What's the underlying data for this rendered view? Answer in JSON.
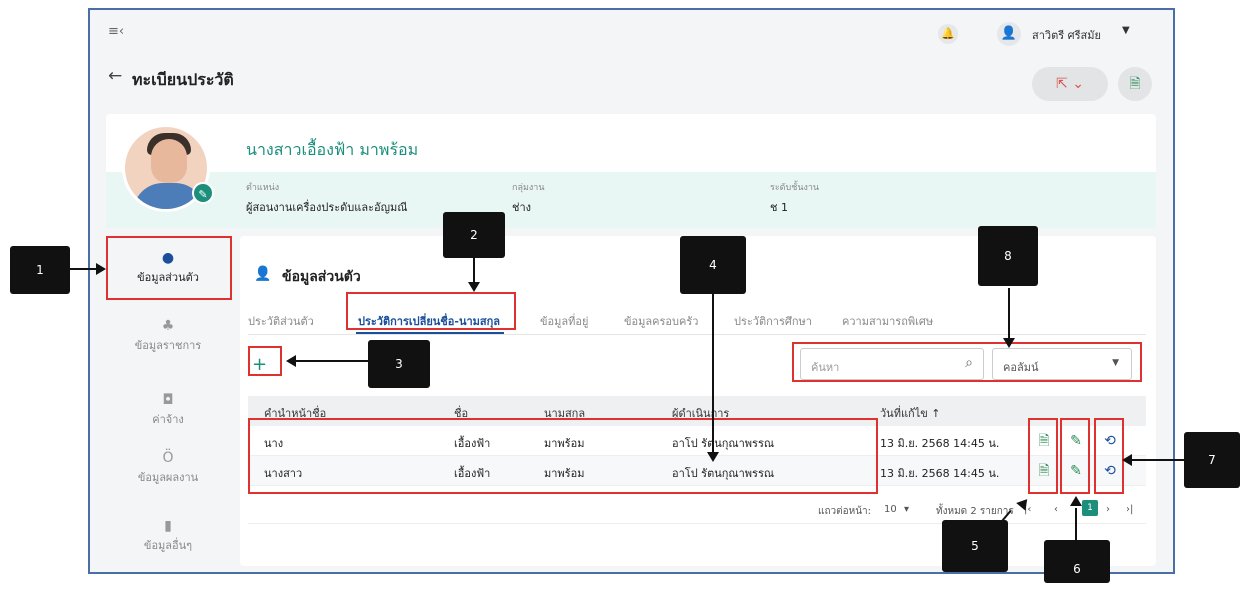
{
  "header": {
    "menu_icon": "menu-collapse-icon",
    "user_name": "สาวิตรี ศรีสมัย",
    "page_title": "ทะเบียนประวัติ"
  },
  "profile": {
    "name": "นางสาวเอื้องฟ้า มาพร้อม",
    "fields": [
      {
        "label": "ตำแหน่ง",
        "value": "ผู้สอนงานเครื่องประดับและอัญมณี"
      },
      {
        "label": "กลุ่มงาน",
        "value": "ช่าง"
      },
      {
        "label": "ระดับชั้นงาน",
        "value": "ช 1"
      }
    ]
  },
  "sidebar": {
    "items": [
      {
        "label": "ข้อมูลส่วนตัว",
        "icon": "person-icon"
      },
      {
        "label": "ข้อมูลราชการ",
        "icon": "org-icon"
      },
      {
        "label": "ค่าจ้าง",
        "icon": "money-icon"
      },
      {
        "label": "ข้อมูลผลงาน",
        "icon": "medal-icon"
      },
      {
        "label": "ข้อมูลอื่นๆ",
        "icon": "bookmark-icon"
      }
    ]
  },
  "main": {
    "section_title": "ข้อมูลส่วนตัว",
    "tabs": [
      {
        "label": "ประวัติส่วนตัว"
      },
      {
        "label": "ประวัติการเปลี่ยนชื่อ-นามสกุล"
      },
      {
        "label": "ข้อมูลที่อยู่"
      },
      {
        "label": "ข้อมูลครอบครัว"
      },
      {
        "label": "ประวัติการศึกษา"
      },
      {
        "label": "ความสามารถพิเศษ"
      }
    ],
    "search_placeholder": "ค้นหา",
    "column_select": "คอลัมน์",
    "table": {
      "headers": [
        "คำนำหน้าชื่อ",
        "ชื่อ",
        "นามสกุล",
        "ผู้ดำเนินการ",
        "วันที่แก้ไข ↑"
      ],
      "rows": [
        [
          "นาง",
          "เอื้องฟ้า",
          "มาพร้อม",
          "อาโป รัตนกุณาพรรณ",
          "13 มิ.ย. 2568 14:45 น."
        ],
        [
          "นางสาว",
          "เอื้องฟ้า",
          "มาพร้อม",
          "อาโป รัตนกุณาพรรณ",
          "13 มิ.ย. 2568 14:45 น."
        ]
      ]
    },
    "pager": {
      "rows_per_page_label": "แถวต่อหน้า:",
      "rows_per_page": "10",
      "total": "ทั้งหมด 2 รายการ",
      "current_page": "1"
    }
  },
  "callouts": [
    "1",
    "2",
    "3",
    "4",
    "5",
    "6",
    "7",
    "8"
  ],
  "colors": {
    "accent": "#1b8f7c",
    "primary": "#1b4f9c",
    "highlight": "#e03131"
  }
}
